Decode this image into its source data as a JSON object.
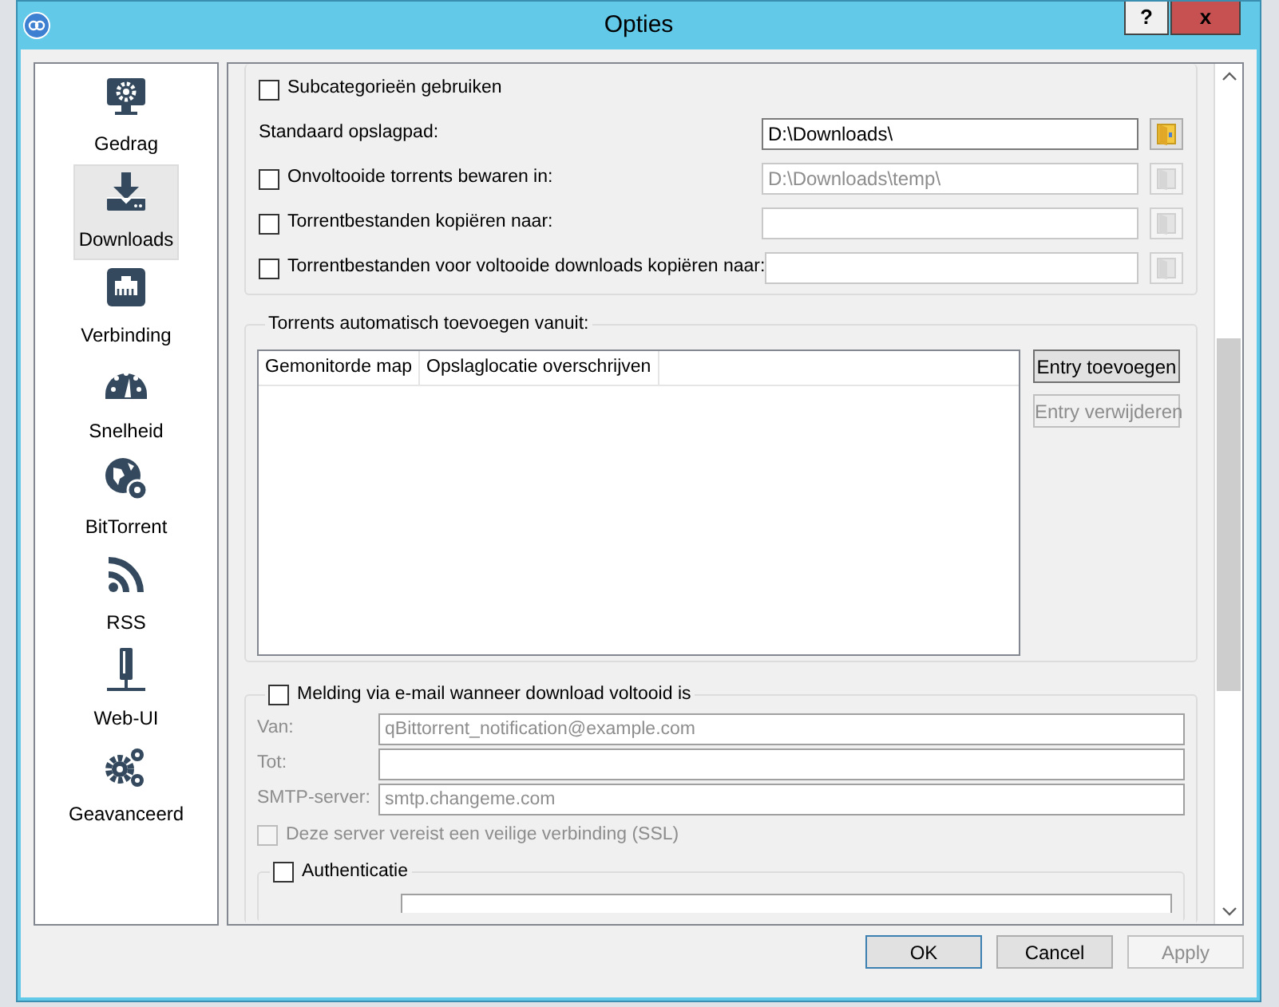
{
  "window": {
    "title": "Opties",
    "help": "?",
    "close": "x"
  },
  "sidebar": {
    "items": [
      {
        "label": "Gedrag",
        "selected": false
      },
      {
        "label": "Downloads",
        "selected": true
      },
      {
        "label": "Verbinding",
        "selected": false
      },
      {
        "label": "Snelheid",
        "selected": false
      },
      {
        "label": "BitTorrent",
        "selected": false
      },
      {
        "label": "RSS",
        "selected": false
      },
      {
        "label": "Web-UI",
        "selected": false
      },
      {
        "label": "Geavanceerd",
        "selected": false
      }
    ]
  },
  "save_group": {
    "subcategories": {
      "label": "Subcategorieën gebruiken",
      "checked": false
    },
    "rows": [
      {
        "kind": "plain",
        "label": "Standaard opslagpad:",
        "value": "D:\\Downloads\\",
        "disabled": false
      },
      {
        "kind": "check",
        "label": "Onvoltooide torrents bewaren in:",
        "checked": false,
        "value": "D:\\Downloads\\temp\\",
        "disabled": true
      },
      {
        "kind": "check",
        "label": "Torrentbestanden kopiëren naar:",
        "checked": false,
        "disabled": true
      },
      {
        "kind": "check",
        "label": "Torrentbestanden voor voltooide downloads kopiëren naar:",
        "checked": false,
        "disabled": true
      }
    ]
  },
  "watch_group": {
    "title": "Torrents automatisch toevoegen vanuit:",
    "columns": [
      "Gemonitorde map",
      "Opslaglocatie overschrijven"
    ],
    "buttons": [
      {
        "label": "Entry toevoegen",
        "disabled": false
      },
      {
        "label": "Entry verwijderen",
        "disabled": true
      }
    ]
  },
  "email_group": {
    "label": "Melding via e-mail wanneer download voltooid is",
    "checked": false,
    "disabled": true,
    "fields": [
      {
        "label": "Van:",
        "value": "qBittorrent_notification@example.com"
      },
      {
        "label": "Tot:"
      },
      {
        "label": "SMTP-server:",
        "value": "smtp.changeme.com"
      }
    ],
    "ssl": {
      "label": "Deze server vereist een veilige verbinding (SSL)",
      "checked": false
    },
    "auth": {
      "label": "Authenticatie",
      "checked": false
    }
  },
  "buttons": [
    {
      "label": "OK",
      "default": true,
      "disabled": false
    },
    {
      "label": "Cancel",
      "default": false,
      "disabled": false
    },
    {
      "label": "Apply",
      "default": false,
      "disabled": true
    }
  ]
}
